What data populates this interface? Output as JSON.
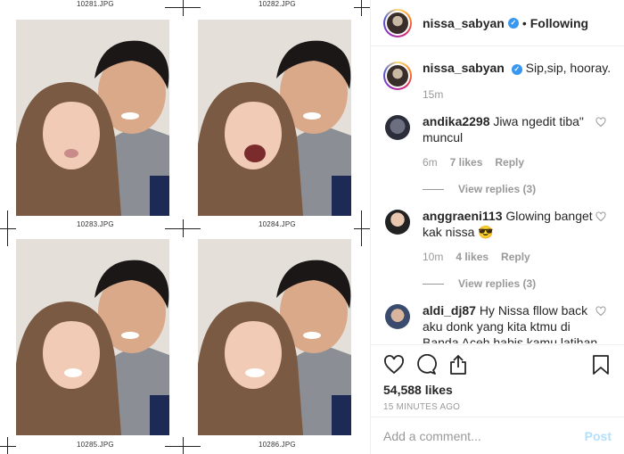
{
  "photo_sheet": {
    "labels": [
      "10281.JPG",
      "10282.JPG",
      "10283.JPG",
      "10284.JPG",
      "10285.JPG",
      "10286.JPG"
    ]
  },
  "post": {
    "header": {
      "username": "nissa_sabyan",
      "verified_icon": "verified-badge-icon",
      "separator": "•",
      "follow_status": "Following"
    },
    "caption": {
      "username": "nissa_sabyan",
      "text": "Sip,sip, hooray.",
      "time": "15m"
    },
    "comments": [
      {
        "username": "andika2298",
        "text": "Jiwa ngedit tiba\" muncul",
        "time": "6m",
        "likes": "7 likes",
        "reply": "Reply",
        "view_replies": "View replies (3)"
      },
      {
        "username": "anggraeni113",
        "text": "Glowing banget kak nissa 😎",
        "time": "10m",
        "likes": "4 likes",
        "reply": "Reply",
        "view_replies": "View replies (3)"
      },
      {
        "username": "aldi_dj87",
        "text": "Hy Nissa fllow back aku donk yang kita ktmu di Banda Aceh habis kamu latihan yg disabilitas itu",
        "time": "",
        "likes": "",
        "reply": "",
        "view_replies": ""
      }
    ],
    "actions": {
      "icons": [
        "heart-icon",
        "comment-icon",
        "share-icon",
        "bookmark-icon"
      ],
      "likes": "54,588 likes",
      "time": "15 MINUTES AGO"
    },
    "add_comment": {
      "placeholder": "Add a comment...",
      "post_label": "Post"
    },
    "colors": {
      "accent": "#3897f0",
      "post_disabled": "#b2dffc",
      "muted": "#999999",
      "text": "#262626"
    }
  }
}
